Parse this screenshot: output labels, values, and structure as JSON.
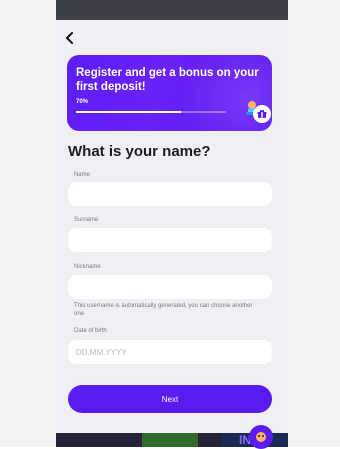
{
  "banner": {
    "title": "Register and get a bonus on your first deposit!",
    "progress_label": "70%",
    "progress": 0.7
  },
  "form": {
    "heading": "What is your name?",
    "name_label": "Name",
    "surname_label": "Surname",
    "nickname_label": "Nickname",
    "nickname_hint": "This username is automatically generated, you can choose another one",
    "dob_label": "Date of birth",
    "dob_placeholder": "DD.MM.YYYY",
    "next_button": "Next"
  },
  "bottom": {
    "strip_text": "IN"
  },
  "colors": {
    "accent": "#5a1bf0",
    "background": "#f0f0f4"
  },
  "icons": {
    "back": "chevron-left-icon",
    "gift": "gift-icon",
    "mascot": "mascot-icon",
    "chat": "chat-icon"
  }
}
